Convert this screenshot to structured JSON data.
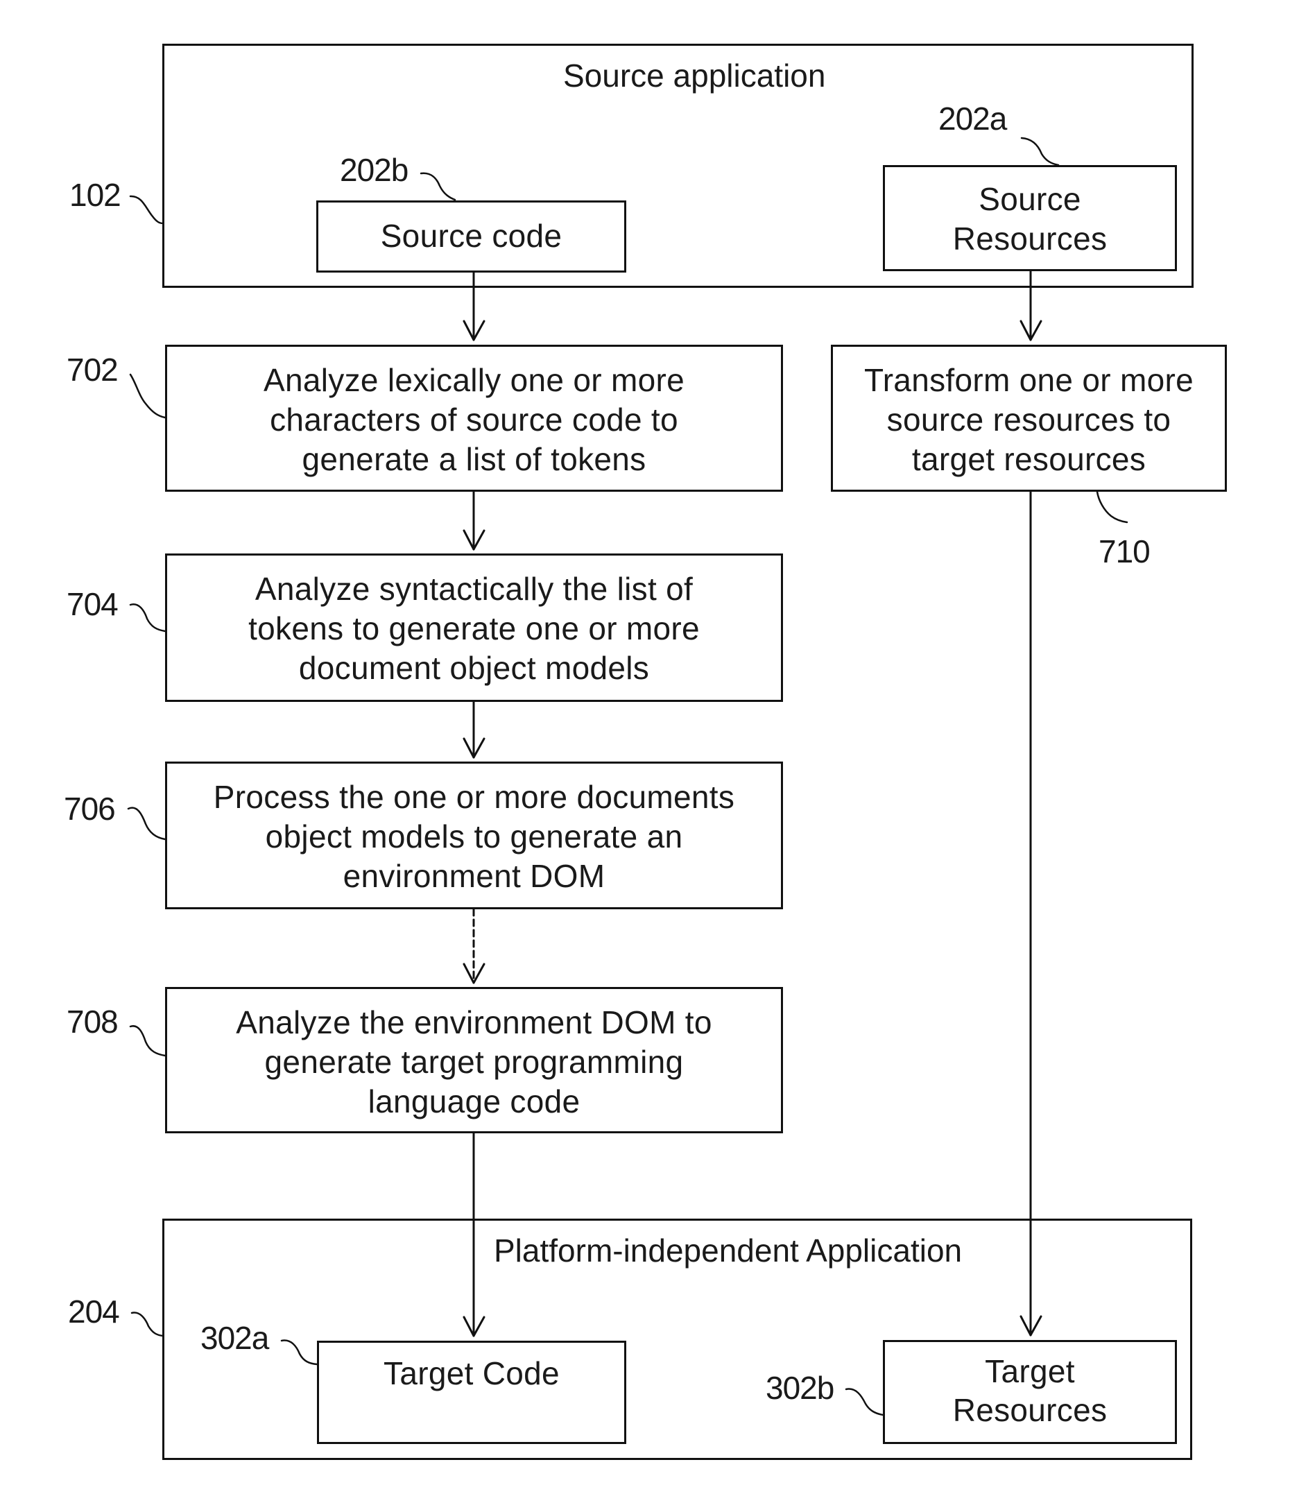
{
  "diagram": {
    "source_application": {
      "ref": "102",
      "title": "Source application",
      "source_code": {
        "ref": "202b",
        "label": "Source code"
      },
      "source_resources": {
        "ref": "202a",
        "label": "Source\nResources"
      }
    },
    "steps": [
      {
        "ref": "702",
        "text": "Analyze lexically one or more\ncharacters of  source code to\ngenerate a list of tokens"
      },
      {
        "ref": "704",
        "text": "Analyze syntactically  the list of\ntokens to generate one or more\ndocument object models"
      },
      {
        "ref": "706",
        "text": "Process the one or more documents\nobject models to generate an\nenvironment DOM"
      },
      {
        "ref": "708",
        "text": "Analyze the environment DOM to\ngenerate target programming\nlanguage code"
      },
      {
        "ref": "710",
        "text": "Transform one or more\nsource resources to\ntarget resources"
      }
    ],
    "platform_application": {
      "ref": "204",
      "title": "Platform-independent Application",
      "target_code": {
        "ref": "302a",
        "label": "Target Code"
      },
      "target_resources": {
        "ref": "302b",
        "label": "Target\nResources"
      }
    },
    "connectors": [
      {
        "from": "Source code",
        "to": "702"
      },
      {
        "from": "702",
        "to": "704"
      },
      {
        "from": "704",
        "to": "706"
      },
      {
        "from": "706",
        "to": "708"
      },
      {
        "from": "708",
        "to": "Target Code"
      },
      {
        "from": "Source Resources",
        "to": "710"
      },
      {
        "from": "710",
        "to": "Target Resources"
      }
    ]
  }
}
